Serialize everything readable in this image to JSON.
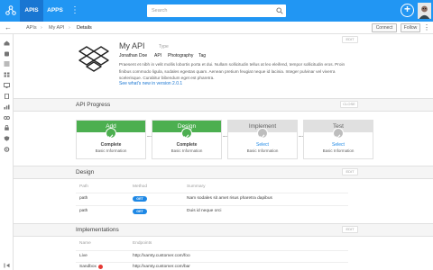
{
  "topbar": {
    "tabs": [
      {
        "label": "APIS"
      },
      {
        "label": "APPS"
      }
    ],
    "more_label": "⋮",
    "search_placeholder": "Search",
    "add_label": "+"
  },
  "breadcrumb": {
    "back_label": "←",
    "items": [
      "APIs",
      "My API",
      "Details"
    ],
    "separator": "›",
    "connect_label": "Connect",
    "follow_label": "Follow",
    "more_label": "⋮"
  },
  "api": {
    "name": "My API",
    "type": "Type",
    "meta": [
      "Jonathan Doe",
      "API",
      "Photography",
      "Tag"
    ],
    "description": "Praesent et nibh in velit mollis lobortis porta et dui. Nullam sollicitudin tellus at leo eleifend, tempor sollicitudin eros. Proin finibus commodo ligula, sodales egestas quam. Aenean pretium feugiat neque id lacinia. Integer pulvinar vel viverra scelerisque. Curabitur bibendum eget est pharetra.",
    "link": "See what's new in version 2.0.1",
    "edit_label": "EDIT"
  },
  "progress": {
    "title": "API Progress",
    "close_label": "CLOSE",
    "steps": [
      {
        "name": "Add",
        "status": "Complete",
        "sub": "Basic Information",
        "done": true
      },
      {
        "name": "Design",
        "status": "Complete",
        "sub": "Basic Information",
        "done": true
      },
      {
        "name": "Implement",
        "status": "Select",
        "sub": "Basic Information",
        "done": false
      },
      {
        "name": "Test",
        "status": "Select",
        "sub": "Basic Information",
        "done": false
      }
    ]
  },
  "design": {
    "title": "Design",
    "edit_label": "EDIT",
    "headers": [
      "Path",
      "Method",
      "Summary"
    ],
    "rows": [
      {
        "path": "path",
        "method": "GET",
        "summary": "Nam sodales sit amet risus pharetra dapibus"
      },
      {
        "path": "path",
        "method": "GET",
        "summary": "Duis id neque orci"
      }
    ]
  },
  "implementations": {
    "title": "Implementations",
    "edit_label": "EDIT",
    "headers": [
      "Name",
      "Endpoints"
    ],
    "rows": [
      {
        "name": "Live",
        "endpoint": "http://xamty.customer.com/foo",
        "alert": false
      },
      {
        "name": "Sandbox",
        "endpoint": "http://xamty.customer.com/bar",
        "alert": true
      }
    ]
  },
  "colors": {
    "primary": "#2196f3",
    "primary_dark": "#1976d2",
    "success": "#4caf50",
    "link": "#1e88e5",
    "alert": "#e53935"
  }
}
